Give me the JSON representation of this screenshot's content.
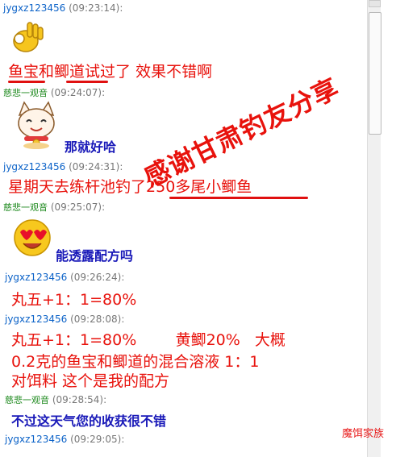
{
  "colors": {
    "alert_red": "#e8120c",
    "msg_blue": "#1818b8",
    "user1": "#0b62c8",
    "user2": "#1f8a1f"
  },
  "messages": [
    {
      "user": "jygxz123456",
      "time": "(09:23:14):",
      "icon": "ok-hand-emoji"
    },
    {
      "text_a": "鱼宝",
      "text_b": "和",
      "text_c": "鲫道",
      "text_d": "试过了  效果不错啊"
    },
    {
      "user": "慈悲一观音",
      "time": "(09:24:07):",
      "icon": "lucky-cat-emoji",
      "text": "那就好哈"
    },
    {
      "user": "jygxz123456",
      "time": "(09:24:31):",
      "text_a": "星期天去练杆池钓",
      "text_b": "了250多尾小鲫鱼"
    },
    {
      "user": "慈悲一观音",
      "time": "(09:25:07):",
      "icon": "heart-eyes-emoji",
      "text": "能透露配方吗"
    },
    {
      "user": "jygxz123456",
      "time": "(09:26:24):",
      "text": "丸五+1：1=80%"
    },
    {
      "user": "jygxz123456",
      "time": "(09:28:08):",
      "line1": "丸五+1：1=80%        黄鲫20%   大概",
      "line2": "0.2克的鱼宝和鲫道的混合溶液 1：1",
      "line3": "对饵料 这个是我的配方"
    },
    {
      "user": "慈悲一观音",
      "time": "(09:28:54):",
      "text": "不过这天气您的收获很不错"
    },
    {
      "user": "jygxz123456",
      "time": "(09:29:05):"
    }
  ],
  "overlay_text": "感谢甘肃钓友分享",
  "watermark": "魔饵家族"
}
